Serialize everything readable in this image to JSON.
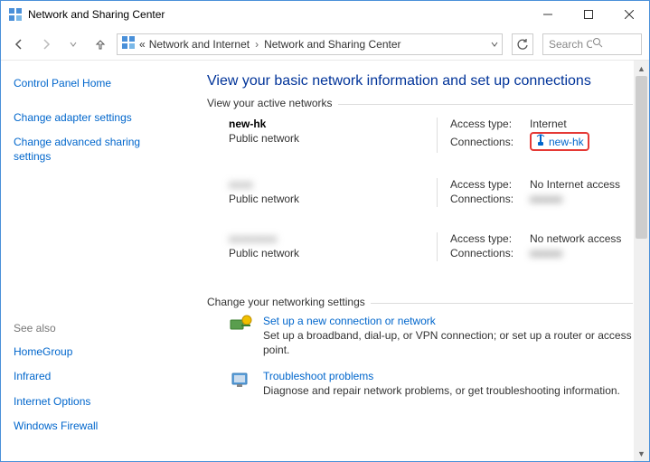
{
  "window": {
    "title": "Network and Sharing Center"
  },
  "breadcrumb": {
    "ellipsis": "«",
    "seg1": "Network and Internet",
    "seg2": "Network and Sharing Center"
  },
  "search": {
    "placeholder": "Search Co..."
  },
  "sidebar": {
    "home": "Control Panel Home",
    "links": [
      "Change adapter settings",
      "Change advanced sharing settings"
    ],
    "seealso_label": "See also",
    "seealso": [
      "HomeGroup",
      "Infrared",
      "Internet Options",
      "Windows Firewall"
    ]
  },
  "main": {
    "heading": "View your basic network information and set up connections",
    "active_label": "View your active networks",
    "labels": {
      "access_type": "Access type:",
      "connections": "Connections:"
    },
    "networks": [
      {
        "name": "new-hk",
        "type": "Public network",
        "access": "Internet",
        "conn_name": "new-hk",
        "conn_link": true,
        "highlight": true,
        "blur_name": false,
        "blur_conn": false
      },
      {
        "name": "xxxx",
        "type": "Public network",
        "access": "No Internet access",
        "conn_name": "xxxxxx",
        "conn_link": false,
        "highlight": false,
        "blur_name": true,
        "blur_conn": true
      },
      {
        "name": "xxxxxxxx",
        "type": "Public network",
        "access": "No network access",
        "conn_name": "xxxxxx",
        "conn_link": false,
        "highlight": false,
        "blur_name": true,
        "blur_conn": true
      }
    ],
    "change_label": "Change your networking settings",
    "settings": [
      {
        "title": "Set up a new connection or network",
        "desc": "Set up a broadband, dial-up, or VPN connection; or set up a router or access point."
      },
      {
        "title": "Troubleshoot problems",
        "desc": "Diagnose and repair network problems, or get troubleshooting information."
      }
    ]
  }
}
